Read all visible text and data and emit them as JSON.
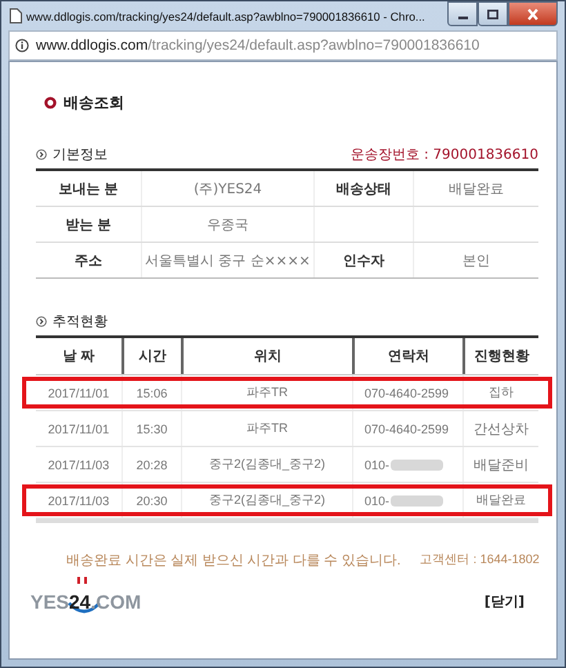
{
  "window": {
    "title": "www.ddlogis.com/tracking/yes24/default.asp?awblno=790001836610 - Chro..."
  },
  "address_bar": {
    "host": "www.ddlogis.com",
    "path": "/tracking/yes24/default.asp?awblno=790001836610"
  },
  "page_title": "배송조회",
  "basic_info": {
    "heading": "기본정보",
    "waybill": "운송장번호 : 790001836610",
    "rows": [
      {
        "label": "보내는 분",
        "value": "(주)YES24",
        "label_2": "배송상태",
        "value_2": "배달완료"
      },
      {
        "label": "받는 분",
        "value": "우종국"
      },
      {
        "label": "주소",
        "value": "서울특별시 중구 순××××",
        "label_2": "인수자",
        "value_2": "본인"
      }
    ]
  },
  "tracking": {
    "heading": "추적현황",
    "columns": [
      "날 짜",
      "시간",
      "위치",
      "연락처",
      "진행현황"
    ],
    "rows": [
      {
        "date": "2017/11/01",
        "time": "15:06",
        "location": "파주TR",
        "contact": "070-4640-2599",
        "status": "집하",
        "highlighted": true,
        "blurred": false
      },
      {
        "date": "2017/11/01",
        "time": "15:30",
        "location": "파주TR",
        "contact": "070-4640-2599",
        "status": "간선상차",
        "highlighted": false,
        "blurred": false
      },
      {
        "date": "2017/11/03",
        "time": "20:28",
        "location": "중구2(김종대_중구2)",
        "contact": "010-",
        "status": "배달준비",
        "highlighted": false,
        "blurred": true
      },
      {
        "date": "2017/11/03",
        "time": "20:30",
        "location": "중구2(김종대_중구2)",
        "contact": "010-",
        "status": "배달완료",
        "highlighted": true,
        "blurred": true
      }
    ]
  },
  "notice": "배송완료 시간은 실제 받으신 시간과 다를 수 있습니다.",
  "customer_center": "고객센터 : 1644-1802",
  "logo": "YES**24**.COM",
  "close_link": "[닫기]"
}
